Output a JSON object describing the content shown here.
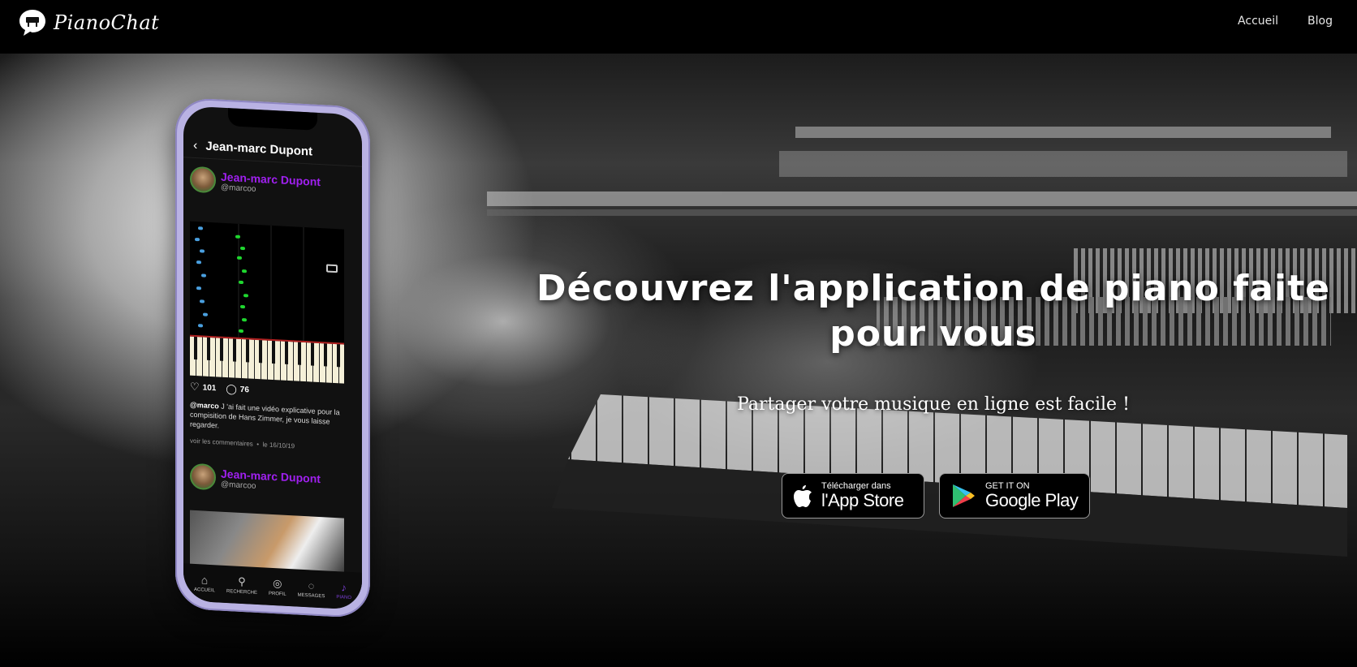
{
  "header": {
    "logo_text": "PianoChat",
    "nav": [
      {
        "label": "Accueil"
      },
      {
        "label": "Blog"
      }
    ]
  },
  "hero": {
    "headline": "Découvrez l'application de piano faite pour vous",
    "subline": "Partager votre musique en ligne est facile !",
    "app_store": {
      "small": "Télécharger dans",
      "big": "l'App Store"
    },
    "google_play": {
      "small": "GET IT ON",
      "big": "Google Play"
    }
  },
  "phone": {
    "screen_title": "Jean-marc Dupont",
    "post": {
      "name": "Jean-marc Dupont",
      "user": "@marcoo",
      "likes": "101",
      "comments": "76",
      "caption_user": "@marco",
      "caption_text": " J 'ai fait une vidéo explicative pour la compisition de Hans Zimmer, je vous laisse regarder.",
      "view_comments": "voir les commentaires",
      "date": "le 16/10/19"
    },
    "post2": {
      "name": "Jean-marc Dupont",
      "user": "@marcoo"
    },
    "tabs": [
      {
        "label": "ACCUEIL"
      },
      {
        "label": "RECHERCHE"
      },
      {
        "label": "PROFIL"
      },
      {
        "label": "MESSAGES"
      },
      {
        "label": "PIANO"
      }
    ]
  }
}
